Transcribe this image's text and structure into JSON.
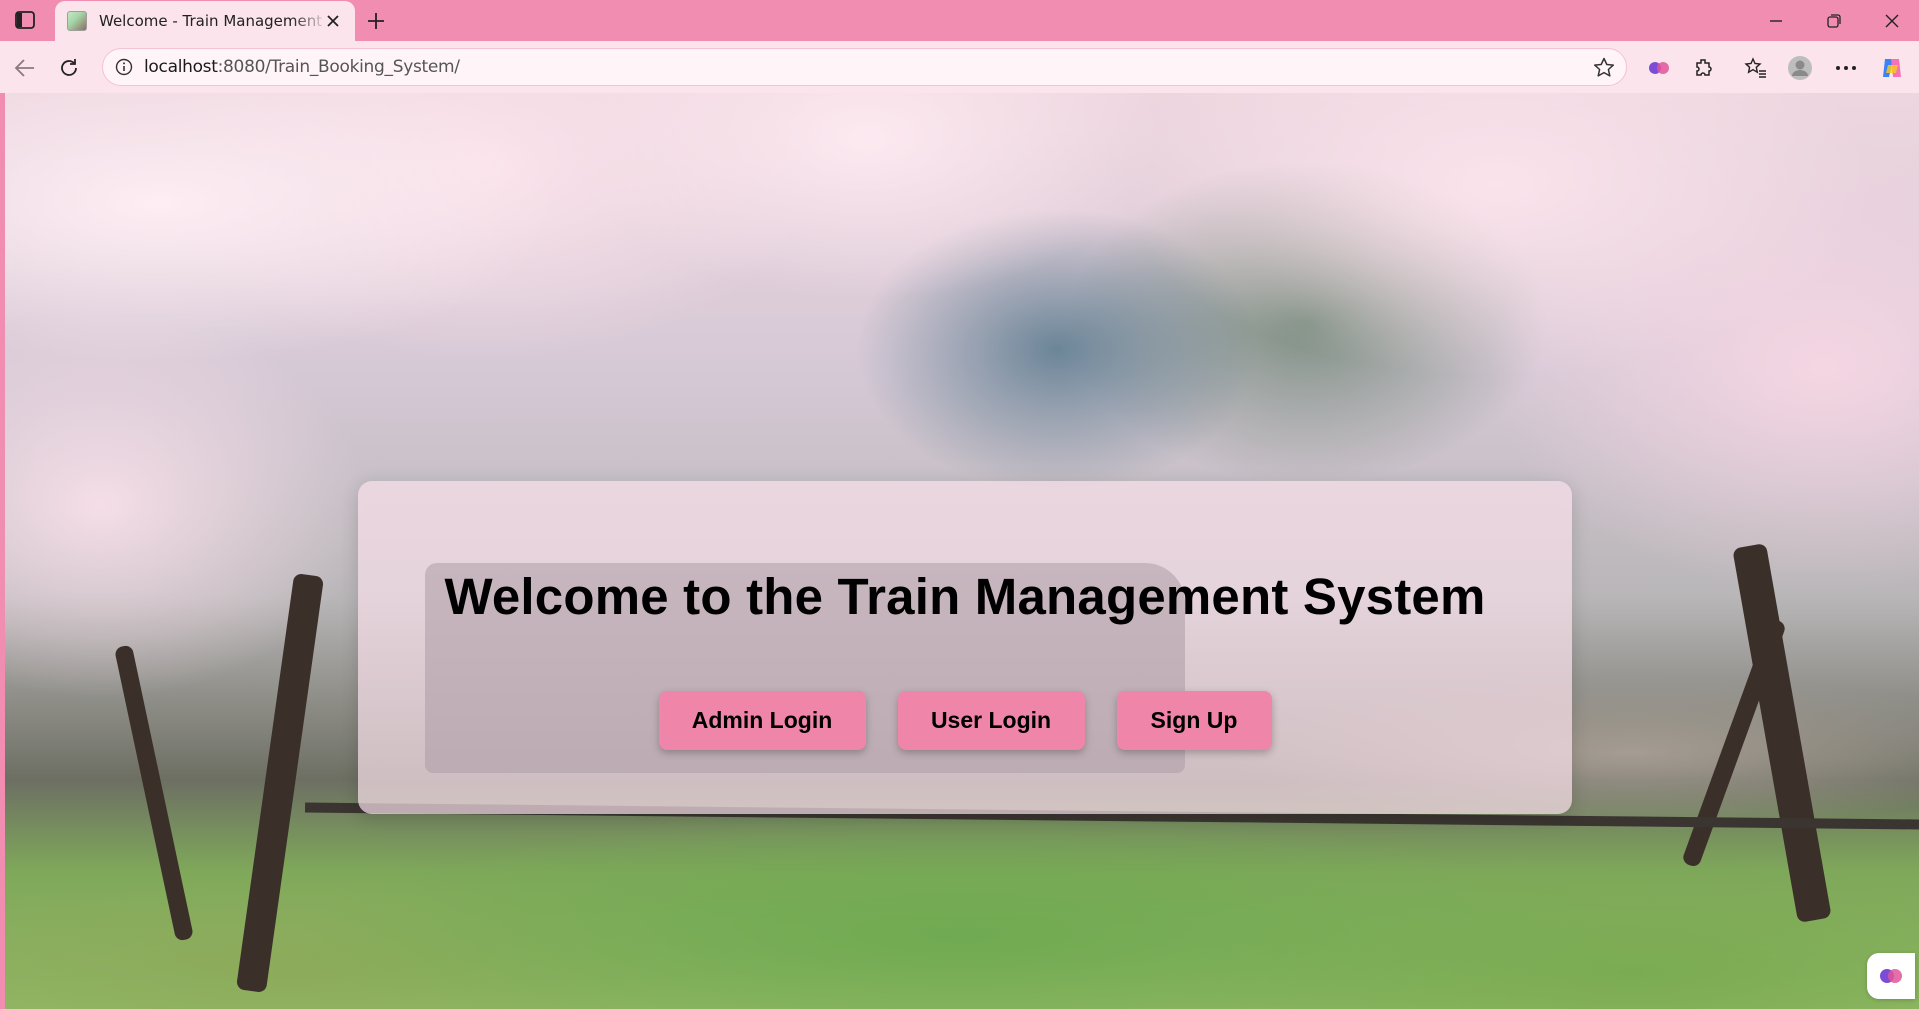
{
  "browser": {
    "tab_title": "Welcome - Train Management System",
    "url_host": "localhost",
    "url_rest": ":8080/Train_Booking_System/",
    "accent": "#f08db0"
  },
  "page": {
    "heading": "Welcome to the Train Management System",
    "buttons": {
      "admin_login": "Admin Login",
      "user_login": "User Login",
      "sign_up": "Sign Up"
    },
    "button_color": "#ef85a8",
    "background_scene": "cherry-blossom trees with steam train on railway track"
  }
}
